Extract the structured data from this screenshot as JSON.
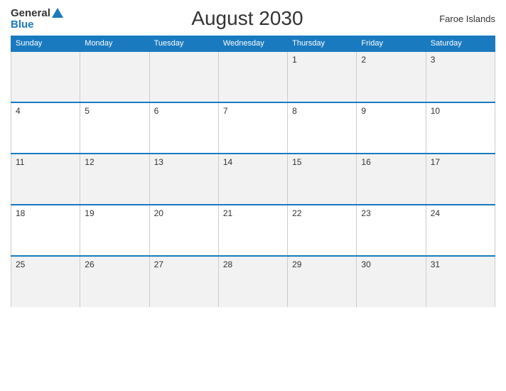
{
  "logo": {
    "general": "General",
    "blue": "Blue",
    "triangle": "▲"
  },
  "title": "August 2030",
  "region": "Faroe Islands",
  "days_of_week": [
    "Sunday",
    "Monday",
    "Tuesday",
    "Wednesday",
    "Thursday",
    "Friday",
    "Saturday"
  ],
  "weeks": [
    [
      "",
      "",
      "",
      "",
      "1",
      "2",
      "3"
    ],
    [
      "4",
      "5",
      "6",
      "7",
      "8",
      "9",
      "10"
    ],
    [
      "11",
      "12",
      "13",
      "14",
      "15",
      "16",
      "17"
    ],
    [
      "18",
      "19",
      "20",
      "21",
      "22",
      "23",
      "24"
    ],
    [
      "25",
      "26",
      "27",
      "28",
      "29",
      "30",
      "31"
    ]
  ]
}
